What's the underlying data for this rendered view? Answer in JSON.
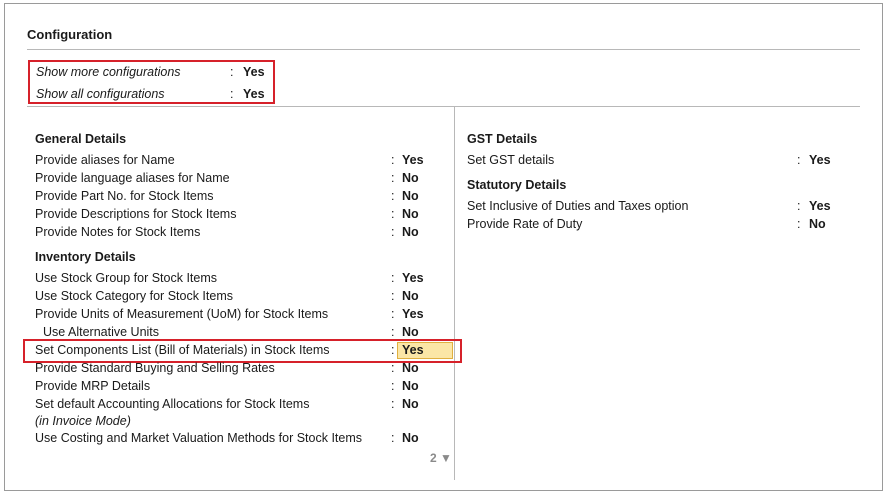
{
  "screen": {
    "title": "Configuration",
    "top_options": [
      {
        "label": "Show more configurations",
        "value": "Yes"
      },
      {
        "label": "Show all configurations",
        "value": "Yes"
      }
    ],
    "left": {
      "general": {
        "heading": "General Details",
        "rows": [
          {
            "label": "Provide aliases for Name",
            "value": "Yes"
          },
          {
            "label": "Provide language aliases for Name",
            "value": "No"
          },
          {
            "label": "Provide Part No. for Stock Items",
            "value": "No"
          },
          {
            "label": "Provide Descriptions for Stock Items",
            "value": "No"
          },
          {
            "label": "Provide Notes for Stock Items",
            "value": "No"
          }
        ]
      },
      "inventory": {
        "heading": "Inventory Details",
        "rows": [
          {
            "label": "Use Stock Group for Stock Items",
            "value": "Yes"
          },
          {
            "label": "Use Stock Category for Stock Items",
            "value": "No"
          },
          {
            "label": "Provide Units of Measurement (UoM) for Stock Items",
            "value": "Yes"
          },
          {
            "label": "Use Alternative Units",
            "value": "No"
          },
          {
            "label": "Set Components List (Bill of Materials) in Stock Items",
            "value": "Yes"
          },
          {
            "label": "Provide Standard Buying and Selling Rates",
            "value": "No"
          },
          {
            "label": "Provide MRP Details",
            "value": "No"
          },
          {
            "label": "Set default Accounting Allocations for Stock Items",
            "value": "No",
            "note": "(in Invoice Mode)"
          },
          {
            "label": "Use Costing and Market Valuation Methods for Stock Items",
            "value": "No"
          }
        ]
      },
      "page_indicator": "2 ▼"
    },
    "right": {
      "gst": {
        "heading": "GST Details",
        "rows": [
          {
            "label": "Set GST details",
            "value": "Yes"
          }
        ]
      },
      "statutory": {
        "heading": "Statutory Details",
        "rows": [
          {
            "label": "Set Inclusive of Duties and Taxes option",
            "value": "Yes"
          },
          {
            "label": "Provide Rate of Duty",
            "value": "No"
          }
        ]
      }
    },
    "colon": ":"
  },
  "colors": {
    "highlight_border": "#d6212a",
    "selected_fill": "#fbe6a6"
  }
}
